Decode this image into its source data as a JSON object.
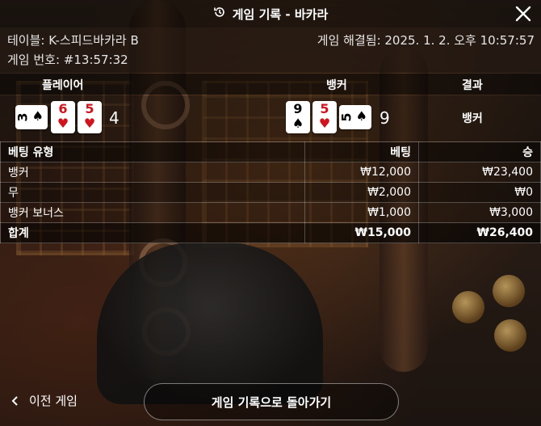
{
  "window": {
    "title": "게임 기록 - 바카라"
  },
  "info": {
    "table_label": "테이블: K-스피드바카라 B",
    "game_number": "게임 번호: #13:57:32",
    "resolved_at": "게임 해결됨: 2025. 1. 2. 오후 10:57:57"
  },
  "hands": {
    "player_header": "플레이어",
    "banker_header": "뱅커",
    "result_header": "결과",
    "player_cards": [
      {
        "rank": "3",
        "suit": "♠",
        "color": "black",
        "sideways": true
      },
      {
        "rank": "6",
        "suit": "♥",
        "color": "red",
        "sideways": false
      },
      {
        "rank": "5",
        "suit": "♥",
        "color": "red",
        "sideways": false
      }
    ],
    "player_score": "4",
    "banker_cards": [
      {
        "rank": "9",
        "suit": "♠",
        "color": "black",
        "sideways": false
      },
      {
        "rank": "5",
        "suit": "♥",
        "color": "red",
        "sideways": false
      },
      {
        "rank": "5",
        "suit": "♠",
        "color": "black",
        "sideways": true
      }
    ],
    "banker_score": "9",
    "result": "뱅커"
  },
  "bets": {
    "headers": [
      "베팅 유형",
      "베팅",
      "승"
    ],
    "rows": [
      [
        "뱅커",
        "₩12,000",
        "₩23,400"
      ],
      [
        "무",
        "₩2,000",
        "₩0"
      ],
      [
        "뱅커 보너스",
        "₩1,000",
        "₩3,000"
      ]
    ],
    "total": [
      "합계",
      "₩15,000",
      "₩26,400"
    ]
  },
  "footer": {
    "prev_label": "이전 게임",
    "back_label": "게임 기록으로 돌아가기"
  },
  "colors": {
    "red_suit": "#d0141e",
    "black_suit": "#000000"
  }
}
